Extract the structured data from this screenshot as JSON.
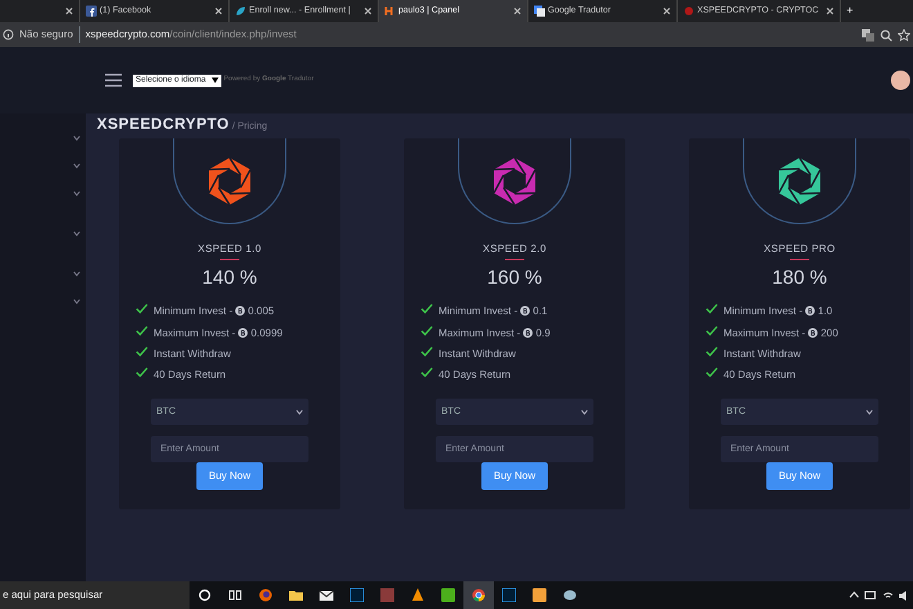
{
  "browser": {
    "tabs": [
      {
        "selected": false
      },
      {
        "title": "(1) Facebook",
        "selected": false
      },
      {
        "title": "Enroll new... - Enrollment |",
        "selected": false
      },
      {
        "title": "paulo3 | Cpanel",
        "selected": true
      },
      {
        "title": "Google Tradutor",
        "selected": false
      },
      {
        "title": "XSPEEDCRYPTO - CRYPTOC",
        "selected": false
      }
    ],
    "new_tab": "+",
    "security": "Não seguro",
    "url_host": "xspeedcrypto.com",
    "url_path": "/coin/client/index.php/invest"
  },
  "header": {
    "language_select": "Selecione o idioma",
    "powered_by": "Powered by",
    "translate_brand": "Google",
    "translate_word": "Tradutor"
  },
  "page_title": {
    "brand": "XSPEEDCRYPTO",
    "section": "/ Pricing"
  },
  "plans": [
    {
      "name": "XSPEED 1.0",
      "color": "#f0521c",
      "percent": "140 %",
      "features": [
        {
          "kind": "coin",
          "label": "Minimum Invest -",
          "amount": "0.005"
        },
        {
          "kind": "coin",
          "label": "Maximum Invest -",
          "amount": "0.0999"
        },
        {
          "kind": "plain",
          "label": "Instant Withdraw"
        },
        {
          "kind": "plain",
          "label": "40 Days Return"
        }
      ],
      "currency": "BTC",
      "placeholder": "Enter Amount",
      "button": "Buy Now"
    },
    {
      "name": "XSPEED 2.0",
      "color": "#c92bb0",
      "percent": "160 %",
      "features": [
        {
          "kind": "coin",
          "label": "Minimum Invest -",
          "amount": "0.1"
        },
        {
          "kind": "coin",
          "label": "Maximum Invest -",
          "amount": "0.9"
        },
        {
          "kind": "plain",
          "label": "Instant Withdraw"
        },
        {
          "kind": "plain",
          "label": "40 Days Return"
        }
      ],
      "currency": "BTC",
      "placeholder": "Enter Amount",
      "button": "Buy Now"
    },
    {
      "name": "XSPEED PRO",
      "color": "#36c79a",
      "percent": "180 %",
      "features": [
        {
          "kind": "coin",
          "label": "Minimum Invest -",
          "amount": "1.0"
        },
        {
          "kind": "coin",
          "label": "Maximum Invest -",
          "amount": "200"
        },
        {
          "kind": "plain",
          "label": "Instant Withdraw"
        },
        {
          "kind": "plain",
          "label": "40 Days Return"
        }
      ],
      "currency": "BTC",
      "placeholder": "Enter Amount",
      "button": "Buy Now"
    }
  ],
  "taskbar": {
    "search": "e aqui para pesquisar",
    "apps": [
      {
        "kind": "cortana",
        "selected": false
      },
      {
        "kind": "taskview",
        "selected": false
      },
      {
        "kind": "firefox",
        "selected": false
      },
      {
        "kind": "folder",
        "selected": false
      },
      {
        "kind": "mail",
        "selected": false
      },
      {
        "kind": "ps",
        "selected": false
      },
      {
        "kind": "photo",
        "selected": false
      },
      {
        "kind": "vlc",
        "selected": false
      },
      {
        "kind": "camtasia",
        "selected": false
      },
      {
        "kind": "chrome",
        "selected": true
      },
      {
        "kind": "ps",
        "selected": false
      },
      {
        "kind": "player",
        "selected": false
      },
      {
        "kind": "paint",
        "selected": false
      }
    ]
  }
}
